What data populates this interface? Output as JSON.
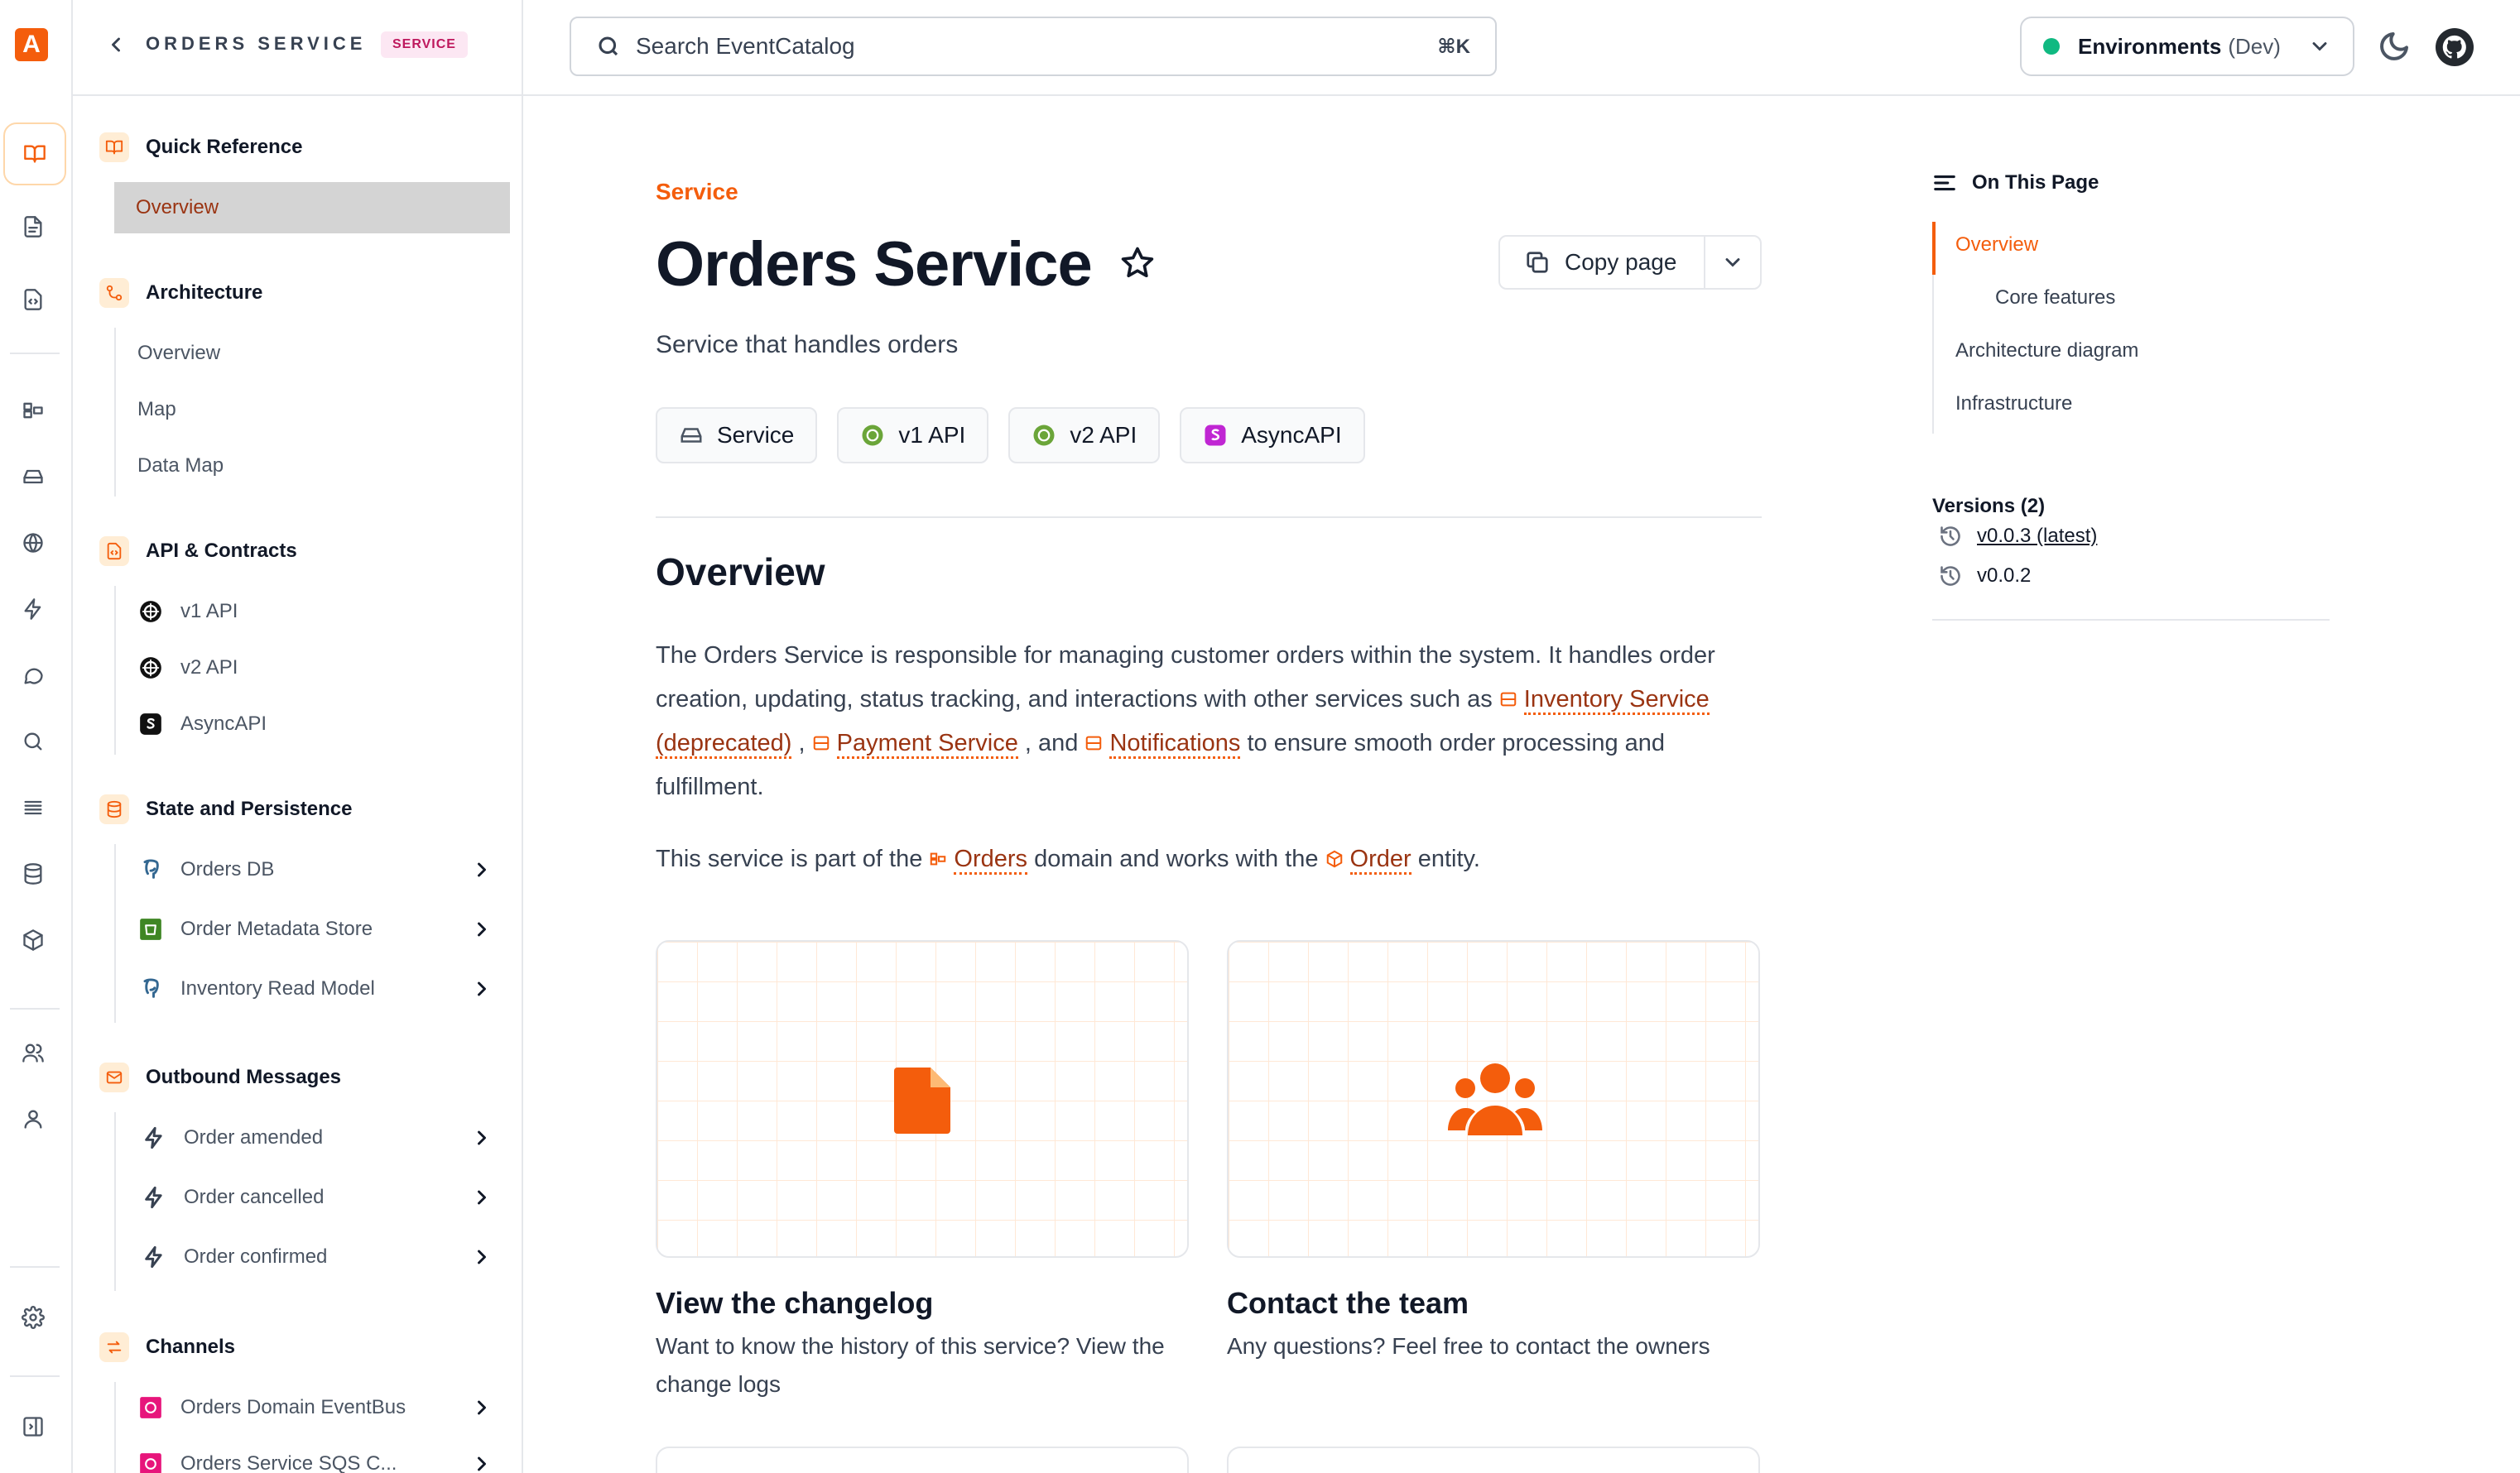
{
  "app": {
    "logo_letter": "A"
  },
  "sidebar": {
    "back_title": "ORDERS SERVICE",
    "badge": "SERVICE",
    "sections": [
      {
        "title": "Quick Reference",
        "items": [
          {
            "label": "Overview"
          }
        ]
      },
      {
        "title": "Architecture",
        "items": [
          {
            "label": "Overview"
          },
          {
            "label": "Map"
          },
          {
            "label": "Data Map"
          }
        ]
      },
      {
        "title": "API & Contracts",
        "items": [
          {
            "label": "v1 API"
          },
          {
            "label": "v2 API"
          },
          {
            "label": "AsyncAPI"
          }
        ]
      },
      {
        "title": "State and Persistence",
        "items": [
          {
            "label": "Orders DB"
          },
          {
            "label": "Order Metadata Store"
          },
          {
            "label": "Inventory Read Model"
          }
        ]
      },
      {
        "title": "Outbound Messages",
        "items": [
          {
            "label": "Order amended"
          },
          {
            "label": "Order cancelled"
          },
          {
            "label": "Order confirmed"
          }
        ]
      },
      {
        "title": "Channels",
        "items": [
          {
            "label": "Orders Domain EventBus"
          },
          {
            "label": "Orders Service SQS C..."
          }
        ]
      }
    ]
  },
  "topbar": {
    "search_placeholder": "Search EventCatalog",
    "search_shortcut": "⌘K",
    "env_label": "Environments",
    "env_value": "(Dev)"
  },
  "main": {
    "kicker": "Service",
    "title": "Orders Service",
    "copy_label": "Copy page",
    "description": "Service that handles orders",
    "pills": [
      {
        "label": "Service"
      },
      {
        "label": "v1 API"
      },
      {
        "label": "v2 API"
      },
      {
        "label": "AsyncAPI"
      }
    ],
    "overview_heading": "Overview",
    "para1": {
      "text_a": "The Orders Service is responsible for managing customer orders within the system. It handles order creation, updating, status tracking, and interactions with other services such as",
      "link_inventory": "Inventory Service (deprecated)",
      "sep1": ",",
      "link_payment": "Payment Service",
      "sep2": ", and",
      "link_notifications": "Notifications",
      "text_b": "to ensure smooth order processing and fulfillment."
    },
    "para2": {
      "text_a": "This service is part of the",
      "link_domain": "Orders",
      "text_b": "domain and works with the",
      "link_entity": "Order",
      "text_c": "entity."
    },
    "cards": [
      {
        "title": "View the changelog",
        "text": "Want to know the history of this service? View the change logs"
      },
      {
        "title": "Contact the team",
        "text": "Any questions? Feel free to contact the owners"
      }
    ]
  },
  "toc": {
    "heading": "On This Page",
    "items": [
      {
        "label": "Overview"
      },
      {
        "label": "Core features"
      },
      {
        "label": "Architecture diagram"
      },
      {
        "label": "Infrastructure"
      }
    ],
    "versions_heading": "Versions (2)",
    "versions": [
      {
        "label": "v0.0.3 (latest)"
      },
      {
        "label": "v0.0.2"
      }
    ]
  },
  "colors": {
    "accent": "#f45d0c",
    "link": "#9a3412",
    "env_dot": "#10b981",
    "badge_bg": "#fce7f3",
    "badge_text": "#be185d"
  }
}
